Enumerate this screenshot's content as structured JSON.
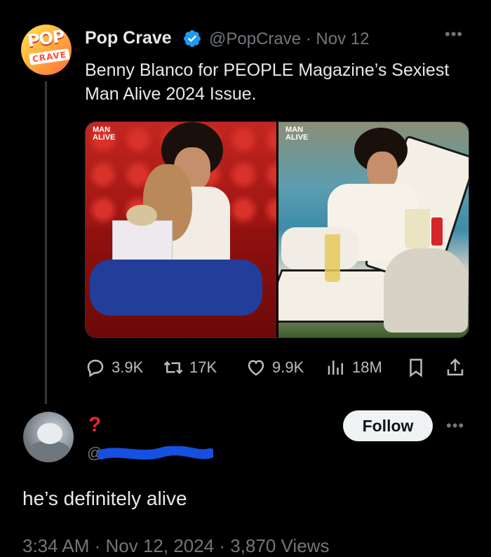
{
  "tweet": {
    "author_name": "Pop Crave",
    "author_logo_text_1": "POP",
    "author_logo_text_2": "CRAVE",
    "handle": "@PopCrave",
    "date": "Nov 12",
    "text": "Benny Blanco for PEOPLE Magazine’s Sexiest Man Alive 2024 Issue.",
    "media": [
      {
        "alt": "Benny Blanco in red velvet setting holding teddy bear and gift box",
        "caption": "MAN\nALIVE"
      },
      {
        "alt": "Benny Blanco lounging poolside with drinks",
        "caption": "MAN\nALIVE"
      }
    ],
    "actions": {
      "replies": "3.9K",
      "reposts": "17K",
      "likes": "9.9K",
      "views": "18M"
    }
  },
  "reply": {
    "name": "?",
    "handle": "@",
    "follow_label": "Follow",
    "text": "he’s definitely alive",
    "footer": "3:34 AM · Nov 12, 2024 · 3,870 Views"
  },
  "colors": {
    "background": "#000000",
    "text": "#e7e9ea",
    "muted": "#71767b",
    "verified": "#1d9bf0",
    "redaction": "#1650e0",
    "reply_name": "#e8232b"
  },
  "icons": [
    "verified-badge-icon",
    "more-icon",
    "reply-icon",
    "repost-icon",
    "like-icon",
    "views-icon",
    "bookmark-icon",
    "share-icon"
  ]
}
